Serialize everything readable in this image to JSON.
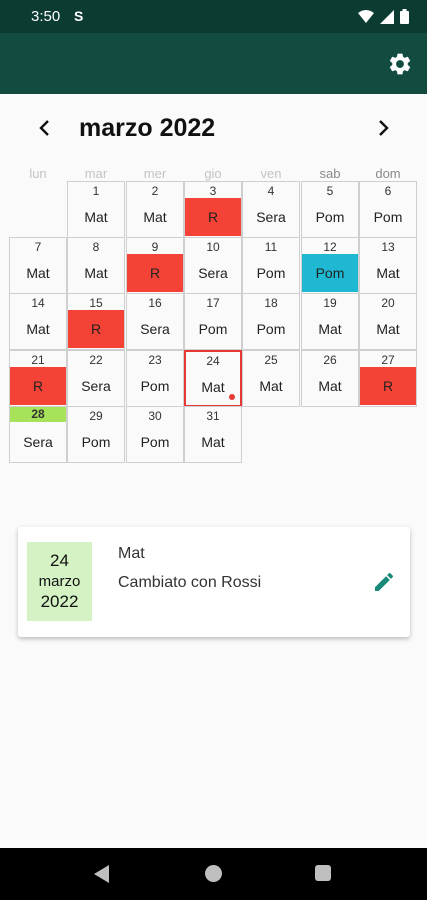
{
  "status_bar": {
    "time": "3:50",
    "notification_glyph": "S"
  },
  "calendar": {
    "month_title": "marzo 2022",
    "weekdays": [
      "lun",
      "mar",
      "mer",
      "gio",
      "ven",
      "sab",
      "dom"
    ],
    "days": [
      {
        "day": "1",
        "shift": "Mat"
      },
      {
        "day": "2",
        "shift": "Mat"
      },
      {
        "day": "3",
        "shift": "R"
      },
      {
        "day": "4",
        "shift": "Sera"
      },
      {
        "day": "5",
        "shift": "Pom"
      },
      {
        "day": "6",
        "shift": "Pom"
      },
      {
        "day": "7",
        "shift": "Mat"
      },
      {
        "day": "8",
        "shift": "Mat"
      },
      {
        "day": "9",
        "shift": "R"
      },
      {
        "day": "10",
        "shift": "Sera"
      },
      {
        "day": "11",
        "shift": "Pom"
      },
      {
        "day": "12",
        "shift": "Pom"
      },
      {
        "day": "13",
        "shift": "Mat"
      },
      {
        "day": "14",
        "shift": "Mat"
      },
      {
        "day": "15",
        "shift": "R"
      },
      {
        "day": "16",
        "shift": "Sera"
      },
      {
        "day": "17",
        "shift": "Pom"
      },
      {
        "day": "18",
        "shift": "Pom"
      },
      {
        "day": "19",
        "shift": "Mat"
      },
      {
        "day": "20",
        "shift": "Mat"
      },
      {
        "day": "21",
        "shift": "R"
      },
      {
        "day": "22",
        "shift": "Sera"
      },
      {
        "day": "23",
        "shift": "Pom"
      },
      {
        "day": "24",
        "shift": "Mat"
      },
      {
        "day": "25",
        "shift": "Mat"
      },
      {
        "day": "26",
        "shift": "Mat"
      },
      {
        "day": "27",
        "shift": "R"
      },
      {
        "day": "28",
        "shift": "Sera"
      },
      {
        "day": "29",
        "shift": "Pom"
      },
      {
        "day": "30",
        "shift": "Pom"
      },
      {
        "day": "31",
        "shift": "Mat"
      }
    ],
    "colors": {
      "rest": "#f44336",
      "highlight_shift": "#1eb8d2",
      "today_marker": "#a6e35a",
      "selected_border": "#e53935"
    }
  },
  "detail": {
    "date_day": "24",
    "date_month": "marzo",
    "date_year": "2022",
    "shift": "Mat",
    "note": "Cambiato con Rossi"
  },
  "icons": {
    "settings": "gear-icon",
    "prev": "chevron-left-icon",
    "next": "chevron-right-icon",
    "edit": "pencil-icon"
  },
  "colors": {
    "status_bar": "#0c3b32",
    "app_bar": "#124b3f",
    "accent": "#1a8a78",
    "date_badge": "#d5f2c4"
  }
}
